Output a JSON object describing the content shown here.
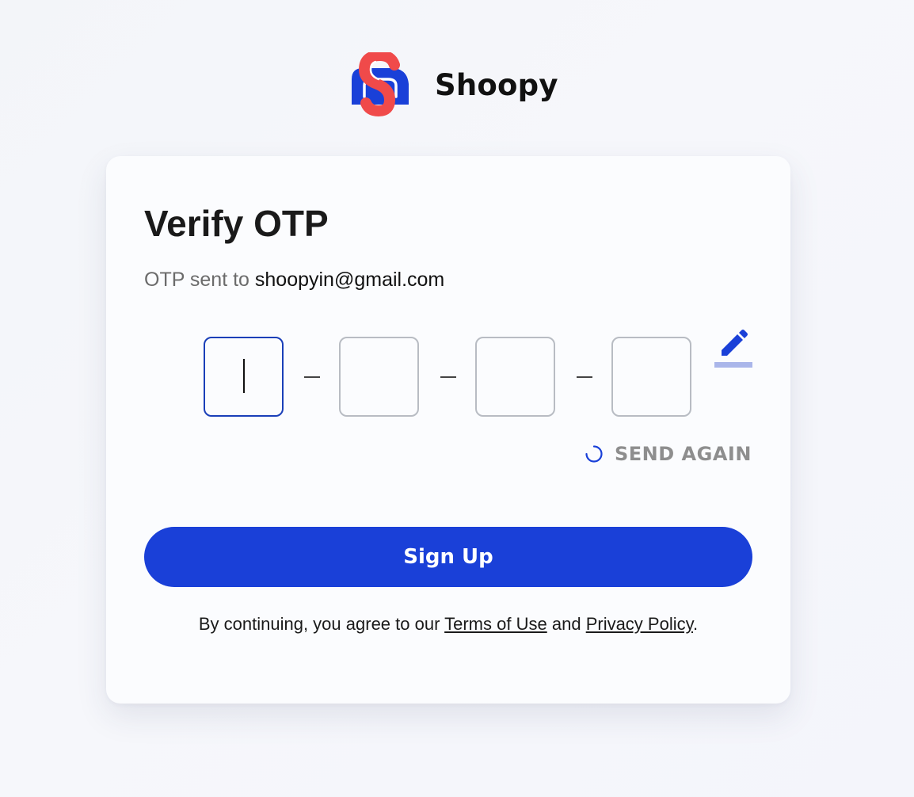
{
  "brand": {
    "name": "Shoopy",
    "logo_icon": "shoopy-s-logo-icon",
    "logo_colors": {
      "primary": "#f04a4a",
      "secondary": "#1a40d8"
    }
  },
  "card": {
    "title": "Verify OTP",
    "subtitle_prefix": "OTP sent to",
    "email": "shoopyin@gmail.com",
    "otp_digits": [
      "",
      "",
      "",
      ""
    ],
    "otp_separator": "–",
    "edit_icon": "pencil-edit-icon",
    "resend": {
      "icon": "loading-spinner-icon",
      "label": "SEND AGAIN"
    },
    "submit_label": "Sign Up",
    "terms": {
      "prefix": "By continuing, you agree to our",
      "terms_link": "Terms of Use",
      "conjunction": "and",
      "privacy_link": "Privacy Policy",
      "suffix": "."
    }
  },
  "colors": {
    "accent": "#1a40d8",
    "focus_border": "#1a3fb8",
    "box_border": "#b8bcc3",
    "muted_text": "#8e8e8e"
  }
}
